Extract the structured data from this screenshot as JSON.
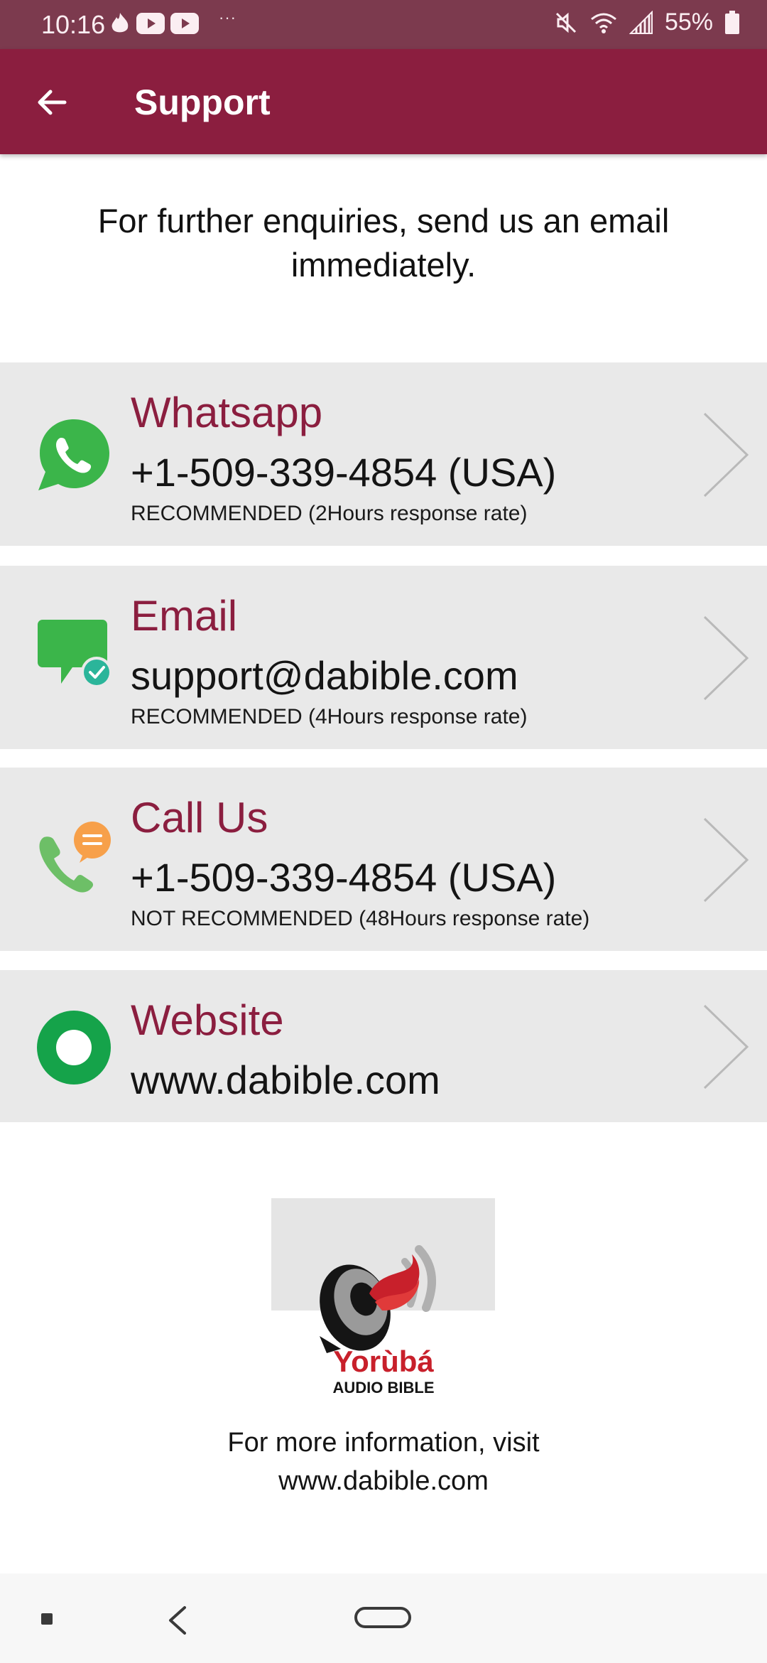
{
  "status_bar": {
    "time": "10:16",
    "more": "···",
    "battery": "55%",
    "icons": [
      "tinder-flame-icon",
      "youtube-icon",
      "youtube-icon",
      "mute-icon",
      "wifi-icon",
      "signal-icon",
      "battery-icon"
    ]
  },
  "app_bar": {
    "title": "Support",
    "back_icon": "arrow-left-icon",
    "color": "#8b1e3f"
  },
  "intro": {
    "text": "For further enquiries, send us an email immediately."
  },
  "contacts": [
    {
      "icon": "whatsapp-icon",
      "title": "Whatsapp",
      "value": "+1-509-339-4854 (USA)",
      "note": "RECOMMENDED (2Hours response rate)"
    },
    {
      "icon": "chat-bubble-check-icon",
      "title": "Email",
      "value": "support@dabible.com",
      "note": "RECOMMENDED (4Hours response rate)"
    },
    {
      "icon": "phone-chat-icon",
      "title": "Call Us",
      "value": "+1-509-339-4854 (USA)",
      "note": "NOT RECOMMENDED (48Hours response rate)"
    },
    {
      "icon": "website-circle-icon",
      "title": "Website",
      "value": "www.dabible.com",
      "note": ""
    }
  ],
  "logo": {
    "line1": "Yorùbá",
    "line2": "AUDIO BIBLE"
  },
  "footer": {
    "line1": "For more information, visit",
    "line2": "www.dabible.com"
  },
  "colors": {
    "accent": "#8b1e3f",
    "card_bg": "#e9e9e9",
    "whatsapp_green": "#3bb54a"
  }
}
